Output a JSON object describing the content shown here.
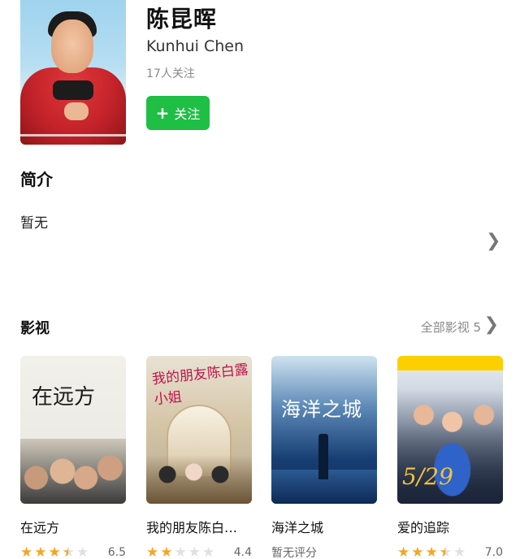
{
  "profile": {
    "name": "陈昆晖",
    "english_name": "Kunhui Chen",
    "followers": "17人关注",
    "follow_label": "关注",
    "follow_icon": "plus-icon",
    "accent_color": "#1fbe45"
  },
  "intro": {
    "title": "简介",
    "text": "暂无",
    "chevron_icon": "chevron-right-icon"
  },
  "films_section": {
    "title": "影视",
    "all_label": "全部影视 5",
    "chevron_icon": "chevron-right-icon"
  },
  "films": [
    {
      "title": "在远方",
      "poster_text": "在远方",
      "stars": 3.5,
      "score": "6.5"
    },
    {
      "title": "我的朋友陈白…",
      "poster_text": "我的朋友陈白露小姐",
      "stars": 2,
      "score": "4.4"
    },
    {
      "title": "海洋之城",
      "poster_text": "海洋之城",
      "stars": 0,
      "score": "",
      "no_rating": "暂无评分"
    },
    {
      "title": "爱的追踪",
      "poster_text": "5/29",
      "stars": 3.5,
      "score": "7.0"
    }
  ],
  "star_color": "#f6a623"
}
